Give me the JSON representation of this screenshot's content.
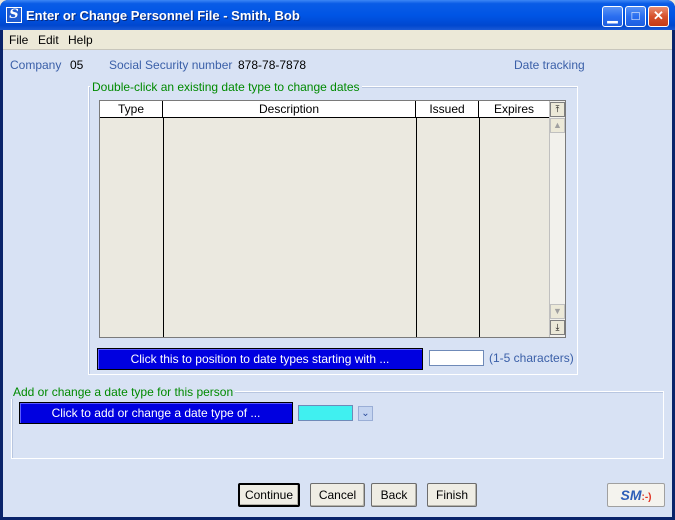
{
  "window": {
    "title": "Enter or Change Personnel File - Smith, Bob",
    "app_icon_letter": "S",
    "minimize": "▁",
    "maximize": "□",
    "close": "✕"
  },
  "menu": [
    {
      "label": "File"
    },
    {
      "label": "Edit"
    },
    {
      "label": "Help"
    }
  ],
  "header": {
    "company_label": "Company",
    "company_value": "05",
    "ssn_label": "Social Security number",
    "ssn_value": "878-78-7878",
    "date_tracking_label": "Date tracking"
  },
  "dates_group": {
    "caption": "Double-click an existing date type to change dates",
    "columns": [
      "Type",
      "Description",
      "Issued",
      "Expires"
    ],
    "rows": [],
    "position_button_label": "Click this to position to date types starting with ...",
    "position_input_value": "",
    "position_hint": "(1-5 characters)"
  },
  "add_group": {
    "caption": "Add or change a date type for this person",
    "add_button_label": "Click to add or change a date type of ...",
    "date_type_value": ""
  },
  "buttons": {
    "continue": "Continue",
    "cancel": "Cancel",
    "back": "Back",
    "finish": "Finish"
  },
  "logo": {
    "text": "SM",
    "smile": ":-)"
  },
  "colors": {
    "accent_blue": "#0000e0",
    "label_blue": "#3a5fa8",
    "caption_green": "#008a00",
    "client_bg": "#d8e2f4",
    "date_type_field": "#40f0f0"
  }
}
